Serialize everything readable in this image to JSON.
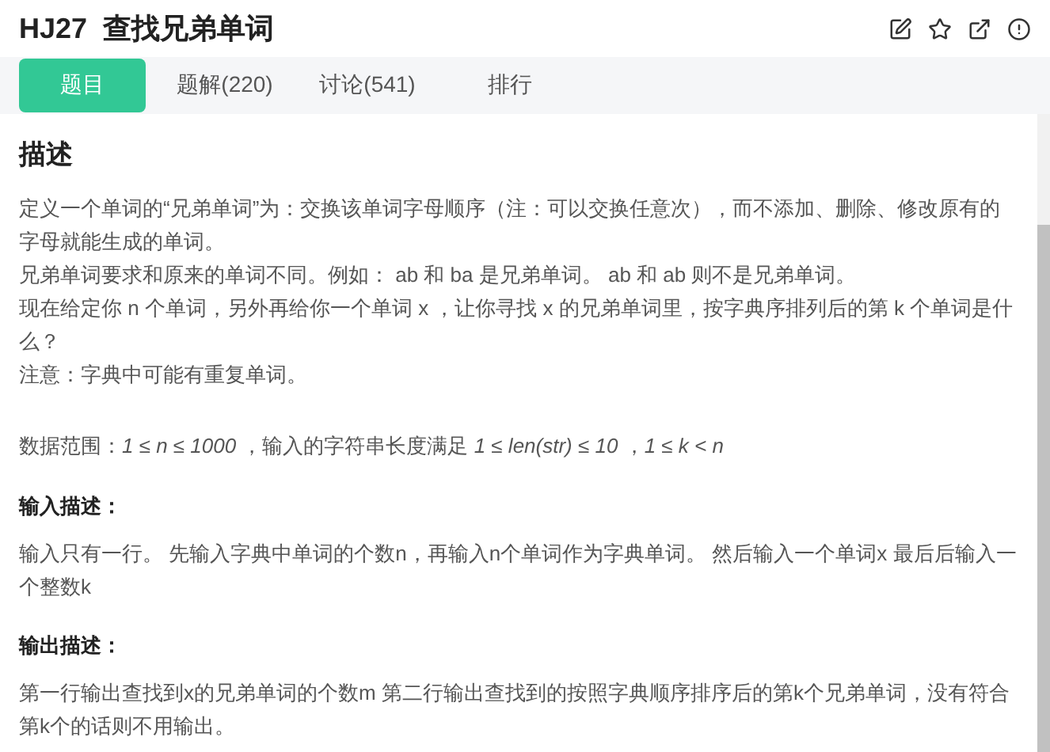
{
  "header": {
    "code": "HJ27",
    "title": "查找兄弟单词"
  },
  "tabs": [
    {
      "label": "题目",
      "selected": true
    },
    {
      "label": "题解(220)",
      "selected": false
    },
    {
      "label": "讨论(541)",
      "selected": false
    },
    {
      "label": "排行",
      "selected": false
    }
  ],
  "sections": [
    {
      "kind": "main",
      "heading": "描述",
      "paragraphs": [
        "定义一个单词的“兄弟单词”为：交换该单词字母顺序（注：可以交换任意次），而不添加、删除、修改原有的字母就能生成的单词。",
        "兄弟单词要求和原来的单词不同。例如： ab 和 ba 是兄弟单词。 ab 和 ab 则不是兄弟单词。",
        "现在给定你 n 个单词，另外再给你一个单词 x ，让你寻找 x 的兄弟单词里，按字典序排列后的第 k 个单词是什么？",
        "注意：字典中可能有重复单词。"
      ],
      "range": "数据范围：*1 ≤ n ≤ 1000* ，输入的字符串长度满足 *1 ≤ len(str) ≤ 10* ，*1 ≤ k < n*"
    },
    {
      "kind": "sub",
      "heading": "输入描述：",
      "paragraphs": [
        "输入只有一行。 先输入字典中单词的个数n，再输入n个单词作为字典单词。 然后输入一个单词x 最后后输入一个整数k"
      ]
    },
    {
      "kind": "sub",
      "heading": "输出描述：",
      "paragraphs": [
        "第一行输出查找到x的兄弟单词的个数m 第二行输出查找到的按照字典顺序排序后的第k个兄弟单词，没有符合第k个的话则不用输出。"
      ]
    }
  ]
}
